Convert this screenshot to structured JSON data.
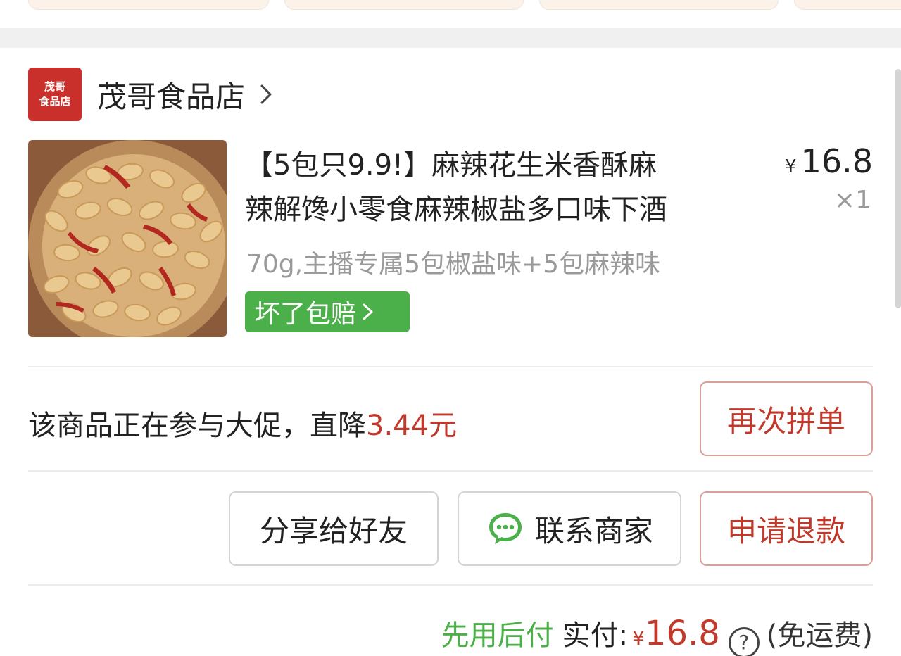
{
  "shop": {
    "logo_line1": "茂哥",
    "logo_line2": "食品店",
    "name": "茂哥食品店"
  },
  "product": {
    "title_line1": "【5包只9.9!】麻辣花生米香酥麻",
    "title_line2": "辣解馋小零食麻辣椒盐多口味下酒",
    "spec": "70g,主播专属5包椒盐味+5包麻辣味",
    "badge": "坏了包赔",
    "price_symbol": "¥",
    "price": "16.8",
    "quantity": "×1"
  },
  "promo": {
    "text": "该商品正在参与大促，直降",
    "amount": "3.44元",
    "reorder_button": "再次拼单"
  },
  "actions": {
    "share": "分享给好友",
    "contact": "联系商家",
    "refund": "申请退款"
  },
  "total": {
    "pay_later": "先用后付",
    "label": "实付:",
    "symbol": "¥",
    "amount": "16.8",
    "help": "?",
    "shipping": "(免运费)"
  },
  "colors": {
    "accent_red": "#c0392b",
    "green": "#4cb04a",
    "logo_red": "#c9302c"
  }
}
